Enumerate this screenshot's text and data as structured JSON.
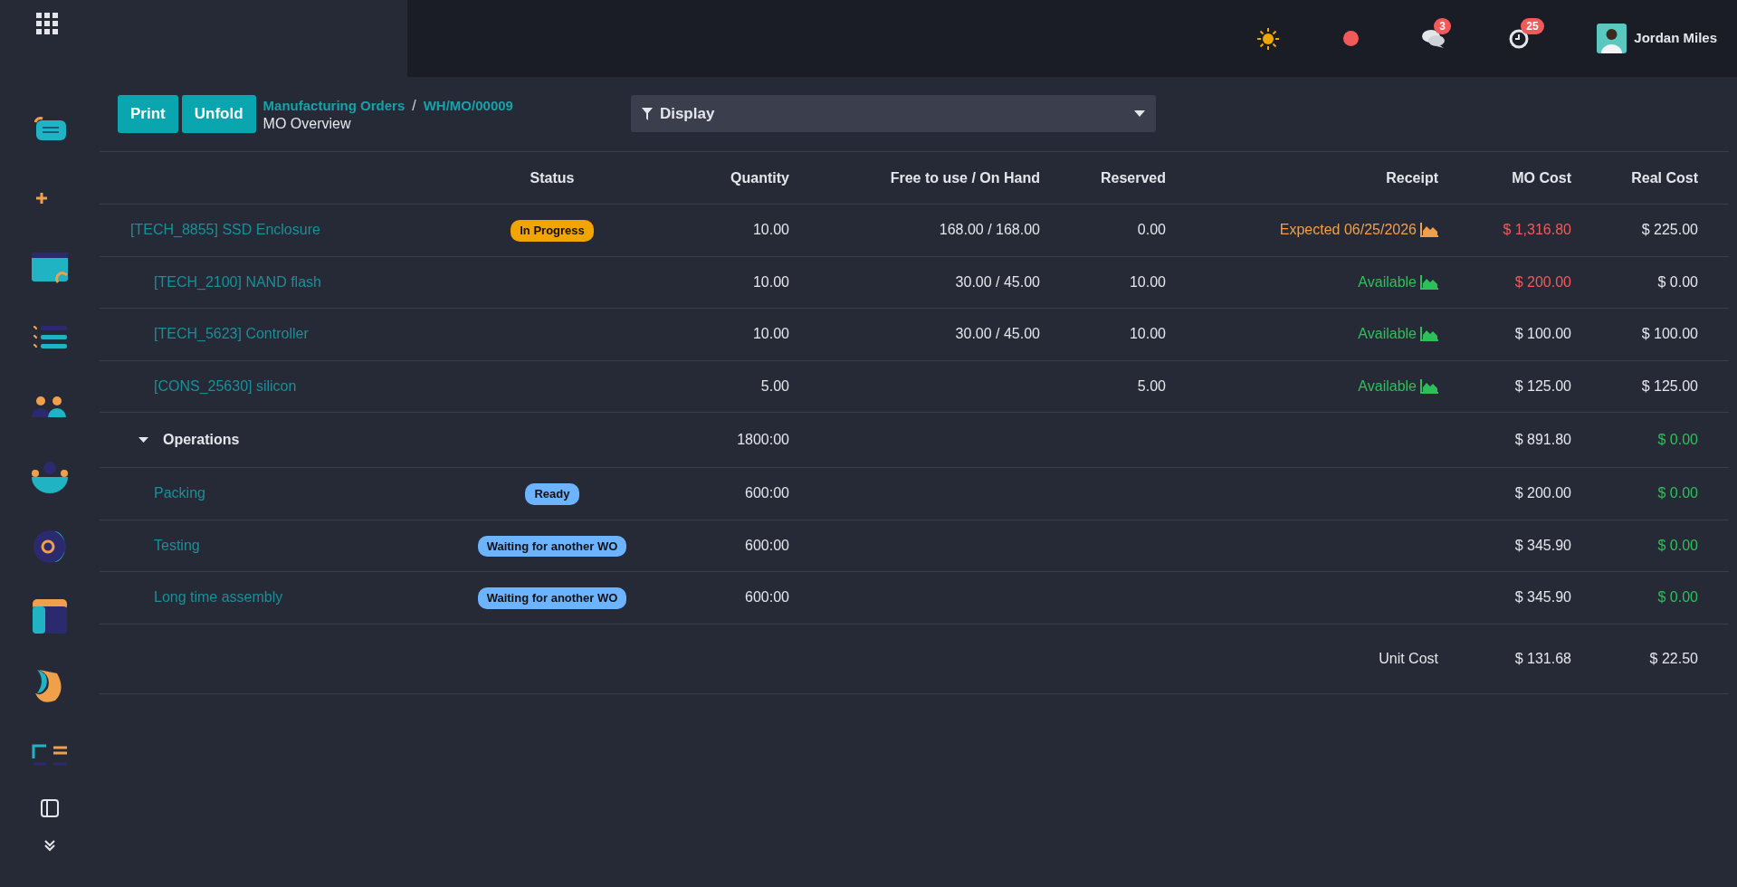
{
  "topbar": {
    "notifications": [
      {
        "kind": "chat",
        "count": "3"
      },
      {
        "kind": "activity",
        "count": "25"
      }
    ],
    "user": {
      "name": "Jordan Miles"
    }
  },
  "toolbar": {
    "buttons": [
      "Print",
      "Unfold"
    ],
    "breadcrumb": [
      "Manufacturing Orders",
      "WH/MO/00009"
    ],
    "separator": "/",
    "title": "MO Overview",
    "display": "Display"
  },
  "table": {
    "columns": [
      "Status",
      "Quantity",
      "Free to use / On Hand",
      "Reserved",
      "Receipt",
      "MO Cost",
      "Real Cost"
    ],
    "rows": [
      {
        "kind": "line",
        "name": "[TECH_8855] SSD Enclosure",
        "status": {
          "label": "In Progress",
          "color": "#f0a500"
        },
        "quantity": "10.00",
        "free_on_hand": "168.00 / 168.00",
        "reserved": "0.00",
        "receipt": {
          "label": "Expected 06/25/2026",
          "color": "#f0a04b"
        },
        "mo_cost": "$ 1,316.80",
        "mo_cost_alert": true,
        "real_cost": "$ 225.00",
        "real_cost_ok": false,
        "children": [
          {
            "kind": "line",
            "name": "[TECH_2100] NAND flash",
            "quantity": "10.00",
            "free_on_hand": "30.00 / 45.00",
            "reserved": "10.00",
            "receipt": {
              "label": "Available",
              "color": "#2fbf5a"
            },
            "mo_cost": "$ 200.00",
            "mo_cost_alert": true,
            "real_cost": "$ 0.00",
            "real_cost_ok": false
          },
          {
            "kind": "line",
            "name": "[TECH_5623] Controller",
            "quantity": "10.00",
            "free_on_hand": "30.00 / 45.00",
            "reserved": "10.00",
            "receipt": {
              "label": "Available",
              "color": "#2fbf5a"
            },
            "mo_cost": "$ 100.00",
            "mo_cost_alert": false,
            "real_cost": "$ 100.00",
            "real_cost_ok": false
          },
          {
            "kind": "line",
            "name": "[CONS_25630] silicon",
            "quantity": "5.00",
            "reserved": "5.00",
            "receipt": {
              "label": "Available",
              "color": "#2fbf5a"
            },
            "mo_cost": "$ 125.00",
            "mo_cost_alert": false,
            "real_cost": "$ 125.00",
            "real_cost_ok": false
          }
        ]
      },
      {
        "kind": "group",
        "name": "Operations",
        "expanded": true,
        "quantity": "1800:00",
        "mo_cost": "$ 891.80",
        "mo_cost_alert": false,
        "real_cost": "$ 0.00",
        "real_cost_ok": true,
        "children": [
          {
            "kind": "line",
            "name": "Packing",
            "status": {
              "label": "Ready",
              "color": "#6cb4ff"
            },
            "quantity": "600:00",
            "mo_cost": "$ 200.00",
            "mo_cost_alert": false,
            "real_cost": "$ 0.00",
            "real_cost_ok": true
          },
          {
            "kind": "line",
            "name": "Testing",
            "status": {
              "label": "Waiting for another WO",
              "color": "#6cb4ff"
            },
            "quantity": "600:00",
            "mo_cost": "$ 345.90",
            "mo_cost_alert": false,
            "real_cost": "$ 0.00",
            "real_cost_ok": true
          },
          {
            "kind": "line",
            "name": "Long time assembly",
            "status": {
              "label": "Waiting for another WO",
              "color": "#6cb4ff"
            },
            "quantity": "600:00",
            "mo_cost": "$ 345.90",
            "mo_cost_alert": false,
            "real_cost": "$ 0.00",
            "real_cost_ok": true
          }
        ]
      }
    ],
    "unit_cost": {
      "label": "Unit Cost",
      "mo_cost": "$ 131.68",
      "real_cost": "$ 22.50"
    }
  }
}
